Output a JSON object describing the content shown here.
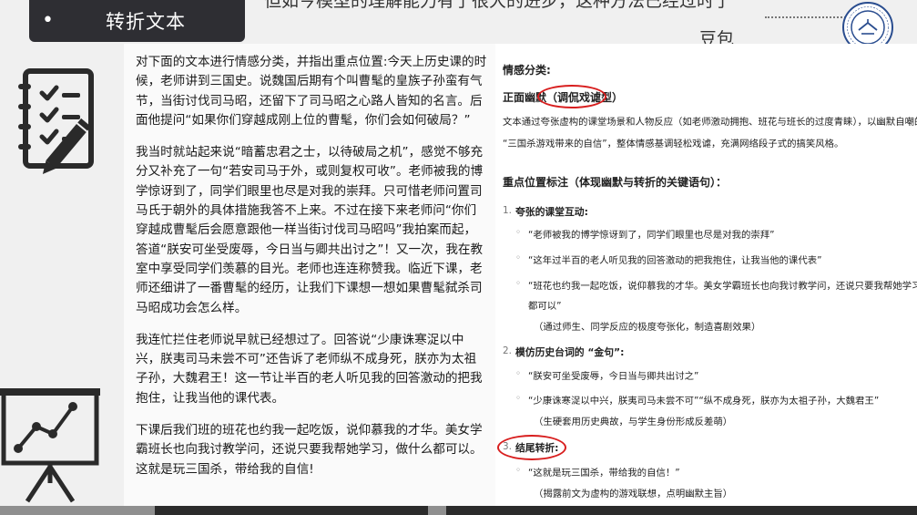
{
  "header": {
    "title": "转折文本",
    "bullet": "•"
  },
  "top_cut_text": "但如今模型的理解能力有了很大的进步，这种方法已经过时了",
  "source_label": "豆包",
  "left_text": {
    "p1": "对下面的文本进行情感分类，并指出重点位置:今天上历史课的时候，老师讲到三国史。说魏国后期有个叫曹髦的皇族子孙蛮有气节，当街讨伐司马昭，还留下了司马昭之心路人皆知的名言。后面他提问“如果你们穿越成刚上位的曹髦，你们会如何破局？”",
    "p2": "我当时就站起来说“暗蓄忠君之士，以待破局之机”，感觉不够充分又补充了一句“若安司马于外，或则复权可收”。老师被我的博学惊讶到了，同学们眼里也尽是对我的崇拜。只可惜老师问置司马氏于朝外的具体措施我答不上来。不过在接下来老师问“你们穿越成曹髦后会愿意跟他一样当街讨伐司马昭吗”我拍案而起，答道“朕安可坐受废辱，今日当与卿共出讨之”！又一次，我在教室中享受同学们羡慕的目光。老师也连连称赞我。临近下课，老师还细讲了一番曹髦的经历，让我们下课想一想如果曹髦弑杀司马昭成功会怎么样。",
    "p3": "我连忙拦住老师说早就已经想过了。回答说“少康诛寒浞以中兴，朕夷司马未尝不可”还告诉了老师纵不成身死，朕亦为太祖子孙，大魏君王！这一节让半百的老人听见我的回答激动的把我抱住，让我当他的课代表。",
    "p4": "下课后我们班的班花也约我一起吃饭，说仰慕我的才华。美女学霸班长也向我讨教学问，还说只要我帮她学习，做什么都可以。",
    "p5": "这就是玩三国杀，带给我的自信!"
  },
  "right": {
    "emotion_title": "情感分类:",
    "category": "正面幽默（调侃戏谑型）",
    "desc1": "文本通过夸张虚构的课堂场景和人物反应（如老师激动拥抱、班花与班长的过度青睐），以幽默自嘲的方式调侃",
    "desc2": "“三国杀游戏带来的自信”，整体情感基调轻松戏谑，充满网络段子式的搞笑风格。",
    "key_title": "重点位置标注（体现幽默与转折的关键语句）：",
    "s1_num": "1.",
    "s1_title": "夸张的课堂互动:",
    "s1_b1": "“老师被我的博学惊讶到了，同学们眼里也尽是对我的崇拜”",
    "s1_b2": "“这年过半百的老人听见我的回答激动的把我抱住，让我当他的课代表”",
    "s1_b3a": "“班花也约我一起吃饭，说仰慕我的才华。美女学霸班长也向我讨教学问，还说只要我帮她学习，做什么",
    "s1_b3b": "都可以”",
    "s1_note": "（通过师生、同学反应的极度夸张化，制造喜剧效果）",
    "s2_num": "2.",
    "s2_title": "模仿历史台词的 “金句”:",
    "s2_b1": "“朕安可坐受废辱，今日当与卿共出讨之”",
    "s2_b2": "“少康诛寒浞以中兴，朕夷司马未尝不可”“纵不成身死，朕亦为太祖子孙，大魏君王”",
    "s2_note": "（生硬套用历史典故，与学生身份形成反差萌）",
    "s3_num": "3.",
    "s3_title": "结尾转折:",
    "s3_b1": "“这就是玩三国杀，带给我的自信！”",
    "s3_note": "（揭露前文为虚构的游戏联想，点明幽默主旨）",
    "bullet": "◦"
  },
  "colors": {
    "header_bg": "#2e2e33",
    "highlight_circle": "#d81e1e",
    "bottom_bar": "#2b2b2b"
  },
  "icons": [
    "checklist-icon",
    "chart-presentation-icon",
    "university-logo-icon"
  ]
}
